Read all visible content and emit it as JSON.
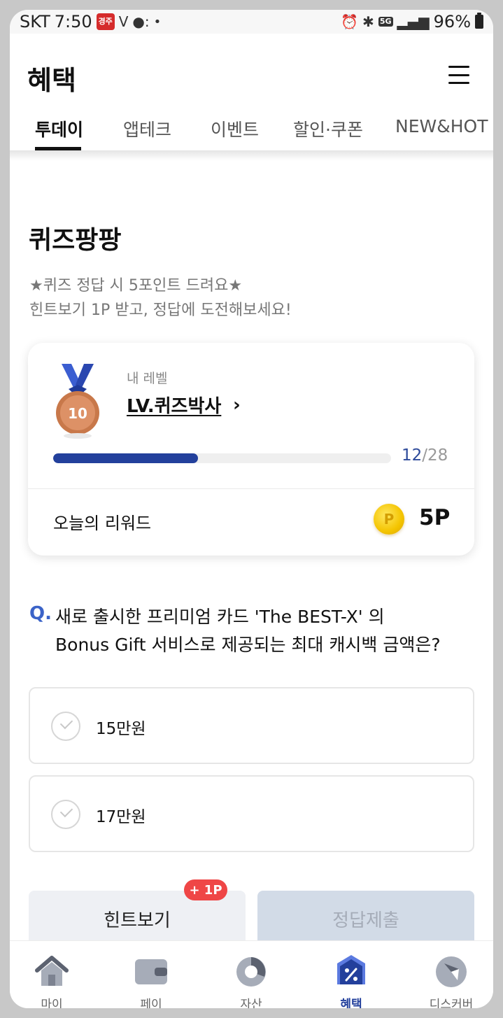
{
  "status_bar": {
    "carrier": "SKT",
    "time": "7:50",
    "battery": "96%",
    "network": "5G",
    "icons": [
      "alarm-icon",
      "bluetooth-icon",
      "signal-icon",
      "battery-icon"
    ]
  },
  "header": {
    "title": "혜택",
    "menu_icon": "hamburger-menu-icon"
  },
  "tabs": [
    {
      "label": "투데이",
      "active": true
    },
    {
      "label": "앱테크",
      "active": false
    },
    {
      "label": "이벤트",
      "active": false
    },
    {
      "label": "할인·쿠폰",
      "active": false
    },
    {
      "label": "NEW&HOT",
      "active": false
    }
  ],
  "quiz": {
    "title": "퀴즈팡팡",
    "subtitle_line1": "★퀴즈 정답 시 5포인트 드려요★",
    "subtitle_line2": "힌트보기 1P 받고, 정답에 도전해보세요!"
  },
  "level_card": {
    "label": "내 레벨",
    "level_name": "LV.퀴즈박사",
    "medal_number": "10",
    "progress_current": "12",
    "progress_total": "/28",
    "progress_fraction": 0.4286,
    "reward_label": "오늘의 리워드",
    "reward_value": "5P",
    "coin_symbol": "P"
  },
  "question": {
    "prefix": "Q.",
    "line1": "새로 출시한 프리미엄 카드 'The BEST-X' 의",
    "line2": "Bonus Gift 서비스로 제공되는 최대 캐시백 금액은?"
  },
  "options": [
    {
      "label": "15만원"
    },
    {
      "label": "17만원"
    }
  ],
  "buttons": {
    "hint_label": "힌트보기",
    "hint_badge": "+ 1P",
    "submit_label": "정답제출"
  },
  "bottom_nav": [
    {
      "label": "마이",
      "icon": "home-icon",
      "active": false
    },
    {
      "label": "페이",
      "icon": "wallet-icon",
      "active": false
    },
    {
      "label": "자산",
      "icon": "pie-chart-icon",
      "active": false
    },
    {
      "label": "혜택",
      "icon": "benefit-tag-icon",
      "active": true
    },
    {
      "label": "디스커버",
      "icon": "compass-icon",
      "active": false
    }
  ],
  "colors": {
    "accent": "#23409c",
    "question_mark": "#3b63c8",
    "badge": "#ef4646",
    "coin": "#f4c400",
    "medal": "#c8784a"
  }
}
